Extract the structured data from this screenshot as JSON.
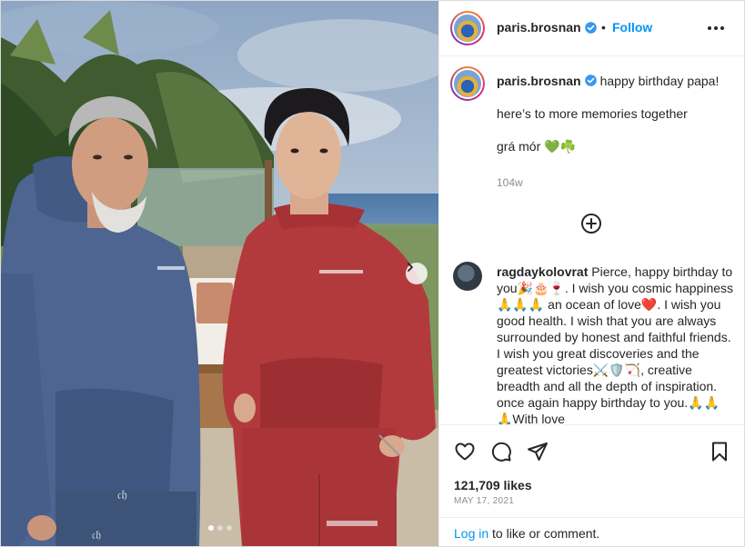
{
  "post": {
    "username": "paris.brosnan",
    "header_separator": "•",
    "follow_label": "Follow",
    "carousel_slide_count": 3,
    "carousel_active_slide": 1
  },
  "caption": {
    "username": "paris.brosnan",
    "line1": "happy birthday papa!",
    "line2": "here’s to more memories together",
    "line3": "grá mór 💚☘️",
    "time": "104w"
  },
  "comment": {
    "username": "ragdaykolovrat",
    "text": "Pierce, happy birthday to you🎉🎂🍷. I wish you cosmic happiness🙏🙏🙏 an ocean of love❤️. I wish you good health. I wish that you are always surrounded by honest and faithful friends. I wish you great discoveries and the greatest victories⚔️🛡️🏹, creative breadth and all the depth of inspiration. once again happy birthday to you.🙏🙏🙏With love"
  },
  "stats": {
    "likes": "121,709 likes",
    "date": "MAY 17, 2021"
  },
  "login": {
    "link": "Log in",
    "rest": " to like or comment."
  },
  "icons": {
    "header_menu": "more-horizontal-icon",
    "verified": "verified-badge-icon",
    "load_more": "plus-circle-icon",
    "like": "heart-icon",
    "comment": "comment-bubble-icon",
    "share": "paper-plane-icon",
    "save": "bookmark-icon",
    "carousel_next": "chevron-right-icon"
  },
  "colors": {
    "link_blue": "#0095f6",
    "verified_blue": "#3897f0",
    "text": "#262626",
    "muted": "#8e8e8e",
    "border": "#efefef"
  }
}
